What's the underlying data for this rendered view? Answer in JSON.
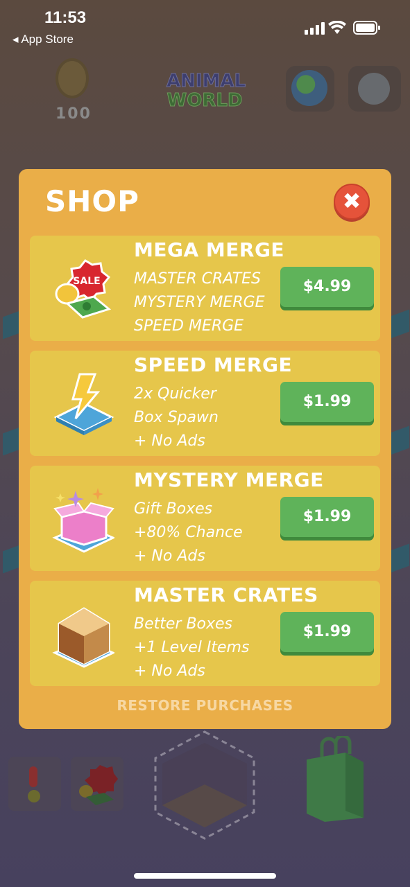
{
  "status_bar": {
    "time": "11:53",
    "back_label": "◂ App Store"
  },
  "top_bar": {
    "coin_count": "100",
    "logo_line1": "ANIMAL",
    "logo_line2": "WORLD"
  },
  "shop": {
    "title": "SHOP",
    "close_glyph": "✖",
    "items": [
      {
        "name": "MEGA MERGE",
        "features": [
          "MASTER CRATES",
          "MYSTERY MERGE",
          "SPEED MERGE"
        ],
        "price": "$4.99",
        "icon": "sale-money-icon"
      },
      {
        "name": "SPEED MERGE",
        "features": [
          "2x Quicker",
          "Box Spawn",
          "+ No Ads"
        ],
        "price": "$1.99",
        "icon": "lightning-icon"
      },
      {
        "name": "MYSTERY MERGE",
        "features": [
          "Gift Boxes",
          "+80% Chance",
          "+ No Ads"
        ],
        "price": "$1.99",
        "icon": "gift-box-icon"
      },
      {
        "name": "MASTER CRATES",
        "features": [
          "Better Boxes",
          "+1 Level Items",
          "+ No Ads"
        ],
        "price": "$1.99",
        "icon": "crate-icon"
      }
    ],
    "restore_label": "RESTORE PURCHASES"
  },
  "colors": {
    "panel": "#eaae48",
    "card": "#e6c64b",
    "buy_button": "#5fb35a",
    "close_button": "#e5533a"
  }
}
